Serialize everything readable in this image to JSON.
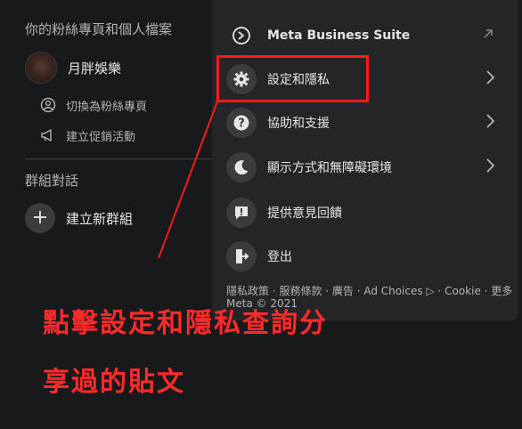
{
  "left_panel": {
    "pages_title": "你的粉絲專頁和個人檔案",
    "page_name": "月胖娛樂",
    "switch_label": "切換為粉絲專頁",
    "promo_label": "建立促銷活動",
    "groups_title": "群組對話",
    "new_group_label": "建立新群組"
  },
  "menu": {
    "items": [
      {
        "label": "Meta Business Suite",
        "icon": "meta-business-suite-icon"
      },
      {
        "label": "設定和隱私",
        "icon": "gear-icon"
      },
      {
        "label": "協助和支援",
        "icon": "question-icon"
      },
      {
        "label": "顯示方式和無障礙環境",
        "icon": "moon-icon"
      },
      {
        "label": "提供意見回饋",
        "icon": "feedback-icon"
      },
      {
        "label": "登出",
        "icon": "logout-icon"
      }
    ],
    "footer_links": "隱私政策 · 服務條款 · 廣告 · Ad Choices ▷ · Cookie · 更多",
    "footer_meta": "Meta © 2021"
  },
  "annotation": {
    "line1": "點擊設定和隱私查詢分",
    "line2": "享過的貼文"
  },
  "colors": {
    "background": "#18191a",
    "menu_background": "#242526",
    "icon_circle": "#3a3b3c",
    "annotation_red": "#ff2a2a"
  }
}
